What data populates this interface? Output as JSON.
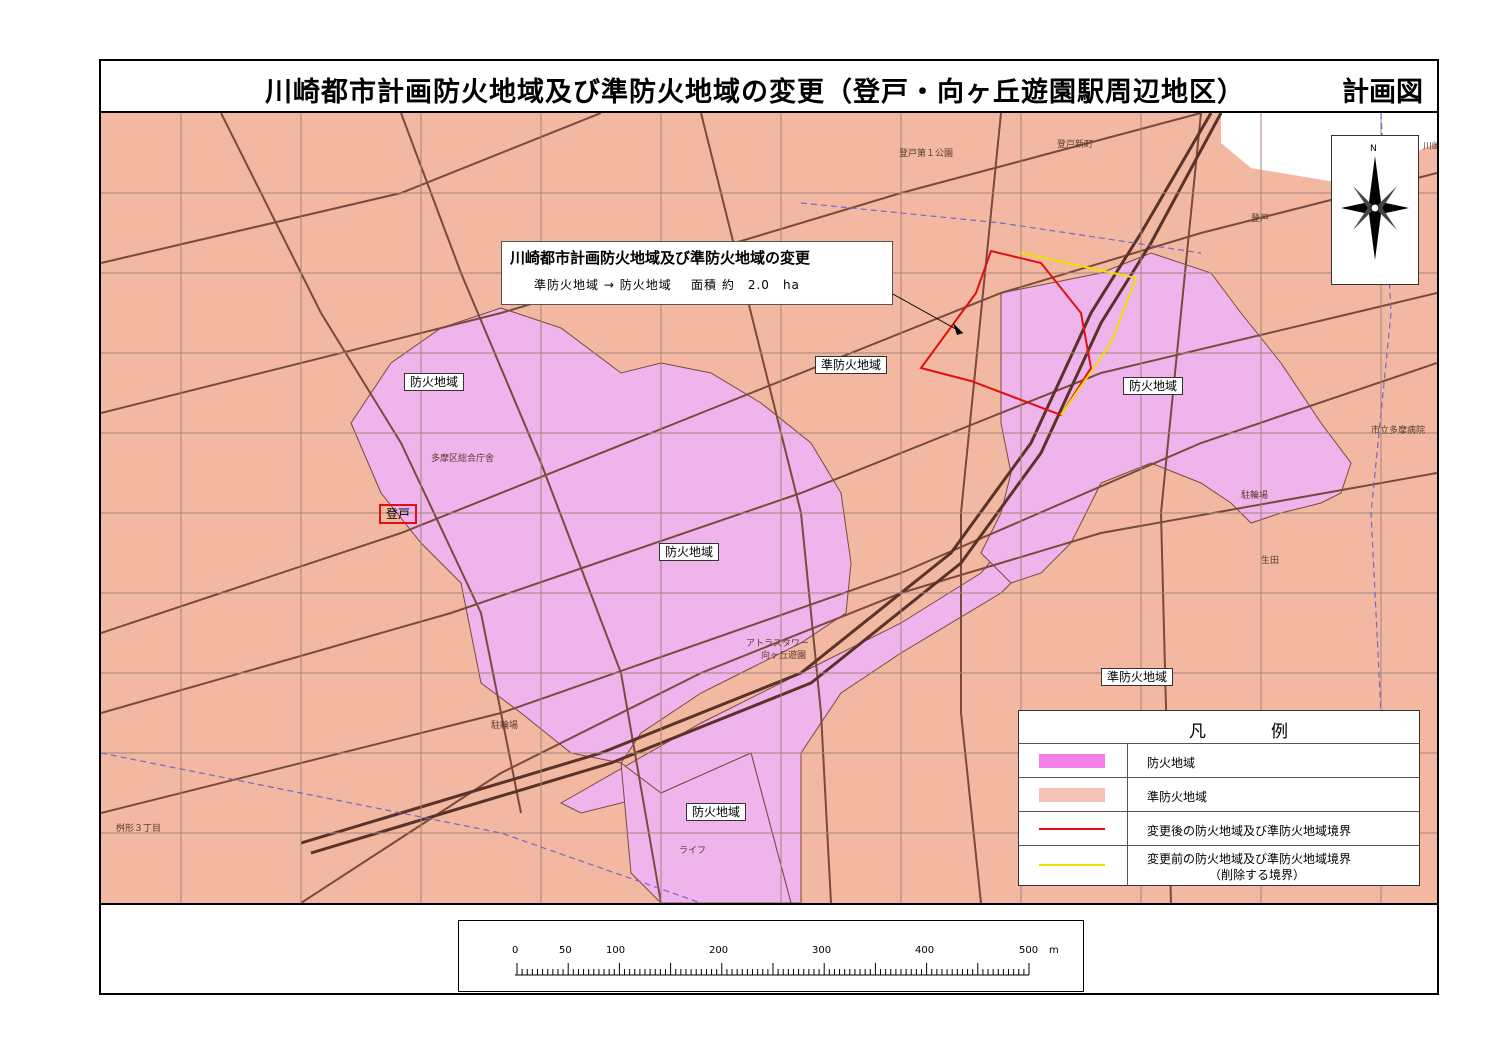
{
  "title": {
    "main": "川崎都市計画防火地域及び準防火地域の変更（登戸・向ヶ丘遊園駅周辺地区）",
    "sub": "計画図"
  },
  "callout": {
    "title": "川崎都市計画防火地域及び準防火地域の変更",
    "from_zone": "準防火地域",
    "arrow": "→",
    "to_zone": "防火地域",
    "area_label": "面積",
    "area_value": "約　2.0　ha"
  },
  "north_arrow": {
    "letter": "N"
  },
  "zone_labels": [
    "防火地域",
    "防火地域",
    "防火地域",
    "防火地域",
    "準防火地域",
    "準防火地域"
  ],
  "station_label": "登戸",
  "place_labels": [
    "川崎",
    "登戸新町",
    "登戸",
    "向ヶ丘遊園",
    "アトラスタワー",
    "多摩区総合庁舎",
    "駐輪場",
    "ライフ",
    "市立多摩病院",
    "生田",
    "桝形３丁目",
    "登戸第１公園",
    "駐輪場"
  ],
  "legend": {
    "title_left": "凡",
    "title_right": "例",
    "items": [
      {
        "label": "防火地域",
        "color": "#f47fe8",
        "kind": "fill"
      },
      {
        "label": "準防火地域",
        "color": "#f5c3b3",
        "kind": "fill"
      },
      {
        "label": "変更後の防火地域及び準防火地域境界",
        "color": "#e01010",
        "kind": "line"
      },
      {
        "label": "変更前の防火地域及び準防火地域境界",
        "label2": "（削除する境界）",
        "color": "#f0e000",
        "kind": "line"
      }
    ]
  },
  "scale": {
    "ticks": [
      "0",
      "50",
      "100",
      "200",
      "300",
      "400",
      "500"
    ],
    "unit": "m"
  },
  "colors": {
    "fire_zone": "#f0b4ec",
    "quasi_fire_zone": "#f2b8a2",
    "road": "#7a4a3c",
    "river": "#ffffff",
    "new_boundary": "#e01010",
    "old_boundary": "#f0e000"
  }
}
